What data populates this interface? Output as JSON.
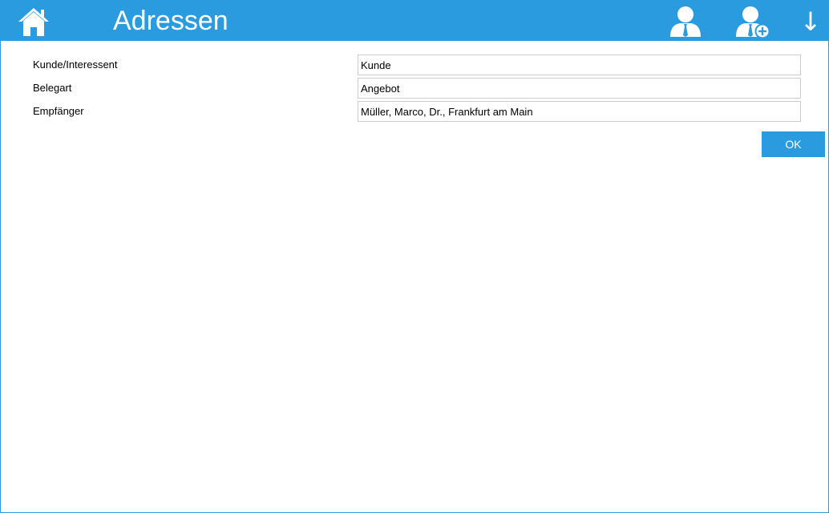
{
  "header": {
    "title": "Adressen",
    "home_icon": "home-icon",
    "person_icon": "person-icon",
    "person_add_icon": "person-add-icon",
    "down_arrow": "↓",
    "accent_color": "#2b9be0"
  },
  "form": {
    "fields": [
      {
        "label": "Kunde/Interessent",
        "value": "Kunde"
      },
      {
        "label": "Belegart",
        "value": "Angebot"
      },
      {
        "label": "Empfänger",
        "value": "Müller, Marco, Dr., Frankfurt am Main"
      }
    ],
    "ok_label": "OK"
  }
}
